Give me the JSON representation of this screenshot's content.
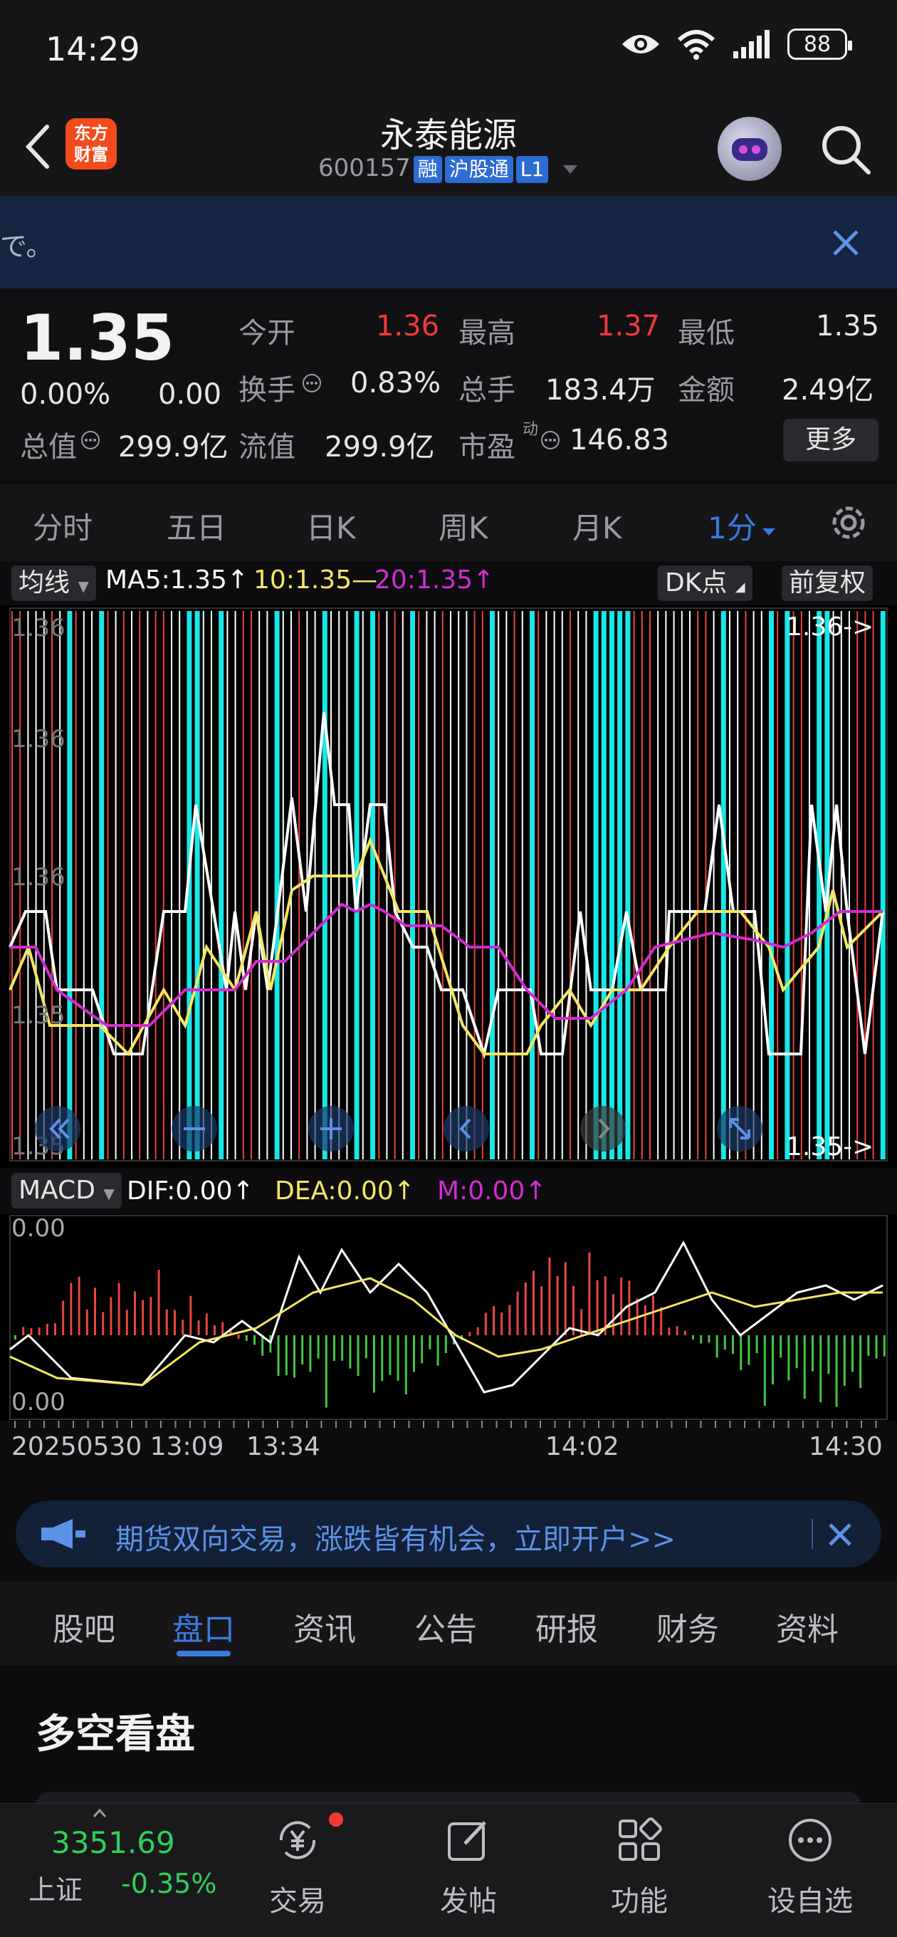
{
  "status": {
    "time": "14:29",
    "battery": "88"
  },
  "header": {
    "brand": "东方财富",
    "stock_name": "永泰能源",
    "code": "600157",
    "tags": [
      "融",
      "沪股通",
      "L1"
    ]
  },
  "notice": {
    "text": "で。"
  },
  "quote": {
    "price": "1.35",
    "change_pct": "0.00%",
    "change_abs": "0.00",
    "open_label": "今开",
    "open": "1.36",
    "high_label": "最高",
    "high": "1.37",
    "low_label": "最低",
    "low": "1.35",
    "turnover_label": "换手",
    "turnover": "0.83%",
    "volume_label": "总手",
    "volume": "183.4万",
    "amount_label": "金额",
    "amount": "2.49亿",
    "mktcap_label": "总值",
    "mktcap": "299.9亿",
    "float_label": "流值",
    "float_cap": "299.9亿",
    "pe_label": "市盈",
    "pe_super": "动",
    "pe": "146.83",
    "more": "更多"
  },
  "chart_tabs": [
    "分时",
    "五日",
    "日K",
    "周K",
    "月K",
    "1分"
  ],
  "legend": {
    "mode": "均线",
    "ma5": "MA5:1.35↑",
    "ma10": "10:1.35—",
    "ma20": "20:1.35↑",
    "dk": "DK点",
    "adjust": "前复权",
    "colors": {
      "ma5": "#ffffff",
      "ma10": "#f5e663",
      "ma20": "#d22bd2",
      "up": "#e8473d",
      "down": "#19e6e6",
      "green": "#3fc83f"
    }
  },
  "main_chart_labels": {
    "y_ticks": [
      "1.36",
      "1.36",
      "1.36",
      "1.35",
      "1.35"
    ],
    "top_marker": "1.36->",
    "bottom_marker": "1.35->"
  },
  "macd": {
    "name": "MACD",
    "dif": "DIF:0.00↑",
    "dea": "DEA:0.00↑",
    "m": "M:0.00↑",
    "top_label": "0.00",
    "bottom_label": "0.00"
  },
  "time_axis": [
    "20250530 13:09",
    "13:34",
    "14:02",
    "14:30"
  ],
  "ad": {
    "text": "期货双向交易，涨跌皆有机会，立即开户>>"
  },
  "info_tabs": [
    "股吧",
    "盘口",
    "资讯",
    "公告",
    "研报",
    "财务",
    "资料"
  ],
  "section_title": "多空看盘",
  "bottom_nav": {
    "index_value": "3351.69",
    "index_name": "上证",
    "index_change": "-0.35%",
    "items": [
      "交易",
      "发帖",
      "功能",
      "设自选"
    ]
  }
}
